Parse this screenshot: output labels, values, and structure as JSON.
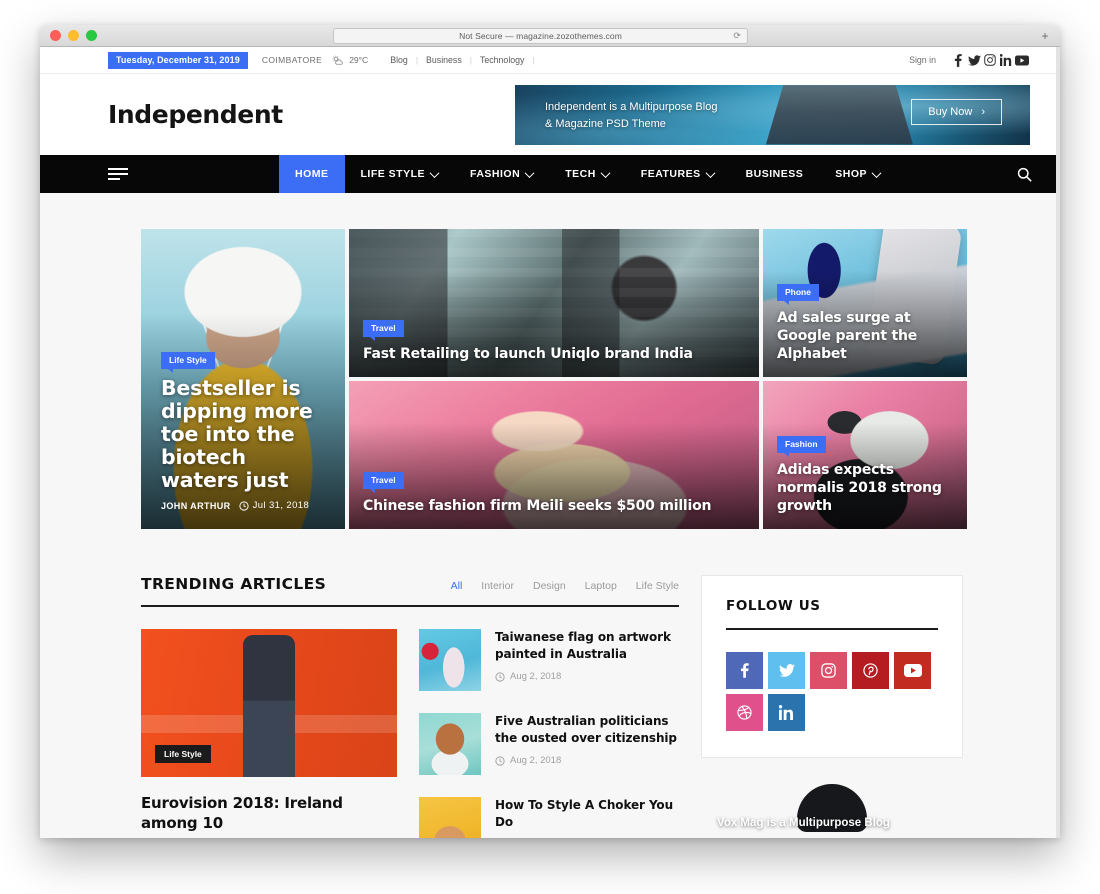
{
  "browser": {
    "url_text": "Not Secure — magazine.zozothemes.com",
    "reload_icon": "⟳",
    "new_tab_icon": "+"
  },
  "topbar": {
    "date": "Tuesday, December 31, 2019",
    "city": "COIMBATORE",
    "temperature": "29°C",
    "links": [
      "Blog",
      "Business",
      "Technology"
    ],
    "separator": "|",
    "sign_in": "Sign in",
    "socials": [
      "facebook-icon",
      "twitter-icon",
      "instagram-icon",
      "linkedin-icon",
      "youtube-icon"
    ]
  },
  "brand": {
    "logo": "Independent",
    "ad": {
      "line1": "Independent is a Multipurpose Blog",
      "line2": "& Magazine PSD Theme",
      "button": "Buy Now",
      "button_chevron": "›"
    }
  },
  "nav": {
    "menu_icon": "hamburger-icon",
    "search_icon": "search-icon",
    "items": [
      {
        "label": "HOME",
        "active": true,
        "caret": false
      },
      {
        "label": "LIFE STYLE",
        "active": false,
        "caret": true
      },
      {
        "label": "FASHION",
        "active": false,
        "caret": true
      },
      {
        "label": "TECH",
        "active": false,
        "caret": true
      },
      {
        "label": "FEATURES",
        "active": false,
        "caret": true
      },
      {
        "label": "BUSINESS",
        "active": false,
        "caret": false
      },
      {
        "label": "SHOP",
        "active": false,
        "caret": true
      }
    ]
  },
  "hero": {
    "cards": [
      {
        "category": "Travel",
        "title": "Fast Retailing to launch Uniqlo brand India"
      },
      {
        "category": "Travel",
        "title": "Chinese fashion firm Meili seeks $500 million"
      },
      {
        "category": "Life Style",
        "title": "Bestseller is dipping more toe into the biotech waters just",
        "author": "JOHN ARTHUR",
        "date": "Jul 31, 2018"
      },
      {
        "category": "Phone",
        "title": "Ad sales surge at Google parent the Alphabet"
      },
      {
        "category": "Fashion",
        "title": "Adidas expects normalis 2018 strong growth"
      }
    ]
  },
  "trending": {
    "title": "TRENDING ARTICLES",
    "filters": [
      {
        "label": "All",
        "active": true
      },
      {
        "label": "Interior",
        "active": false
      },
      {
        "label": "Design",
        "active": false
      },
      {
        "label": "Laptop",
        "active": false
      },
      {
        "label": "Life Style",
        "active": false
      }
    ],
    "featured": {
      "tag": "Life Style",
      "title": "Eurovision 2018: Ireland among 10"
    },
    "posts": [
      {
        "title": "Taiwanese flag on artwork painted in Australia",
        "date": "Aug 2, 2018"
      },
      {
        "title": "Five Australian politicians the ousted over citizenship",
        "date": "Aug 2, 2018"
      },
      {
        "title": "How To Style A Choker You Do",
        "date": ""
      }
    ]
  },
  "sidebar": {
    "follow_title": "FOLLOW US",
    "socials": [
      {
        "name": "facebook-icon",
        "color": "#4f69b8"
      },
      {
        "name": "twitter-icon",
        "color": "#5fc0ef"
      },
      {
        "name": "instagram-icon",
        "color": "#dd4f68"
      },
      {
        "name": "pinterest-icon",
        "color": "#b41c22"
      },
      {
        "name": "youtube-icon",
        "color": "#c22b1f"
      },
      {
        "name": "dribbble-icon",
        "color": "#e0518c"
      },
      {
        "name": "linkedin-icon",
        "color": "#2b73ad"
      }
    ],
    "promo_text": "Vox Mag is a Multipurpose Blog"
  },
  "colors": {
    "accent_blue": "#3b6ef5",
    "nav_black": "#070707",
    "page_bg": "#f7f7f7"
  }
}
